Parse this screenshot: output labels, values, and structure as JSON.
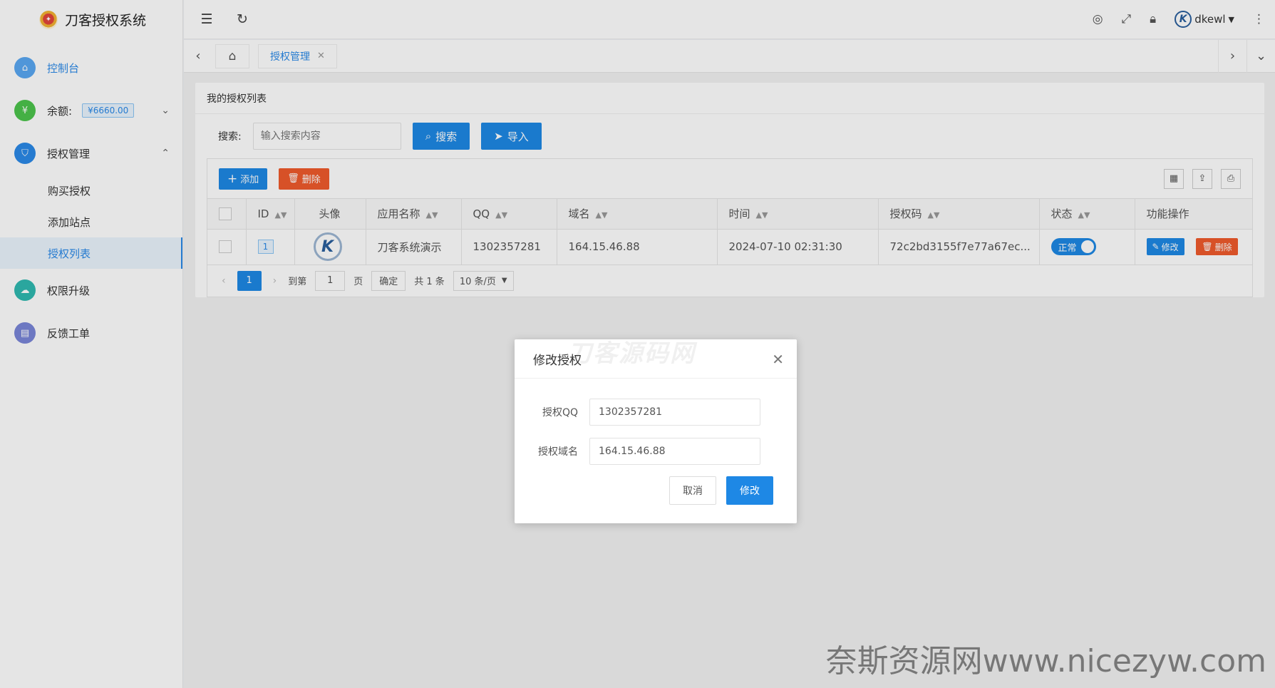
{
  "brand": {
    "title": "刀客授权系统"
  },
  "sidebar": {
    "items": [
      {
        "label": "控制台",
        "icon": "home-icon",
        "color": "#5aa7f2"
      },
      {
        "label": "余额:",
        "badge": "¥6660.00",
        "icon": "money-icon",
        "color": "#4cc54c"
      },
      {
        "label": "授权管理",
        "icon": "shield-icon",
        "color": "#2b8ae8"
      },
      {
        "label": "权限升级",
        "icon": "cloud-up-icon",
        "color": "#2fb9b0"
      },
      {
        "label": "反馈工单",
        "icon": "ticket-icon",
        "color": "#7a86d8"
      }
    ],
    "submenu": [
      {
        "label": "购买授权"
      },
      {
        "label": "添加站点"
      },
      {
        "label": "授权列表"
      }
    ]
  },
  "header": {
    "user": "dkewl"
  },
  "tabs": {
    "active": "授权管理"
  },
  "card": {
    "title": "我的授权列表",
    "search_label": "搜索:",
    "search_placeholder": "输入搜索内容",
    "search_button": "搜索",
    "import_button": "导入"
  },
  "toolbar": {
    "add": "添加",
    "delete": "删除"
  },
  "table": {
    "headers": [
      "ID",
      "头像",
      "应用名称",
      "QQ",
      "域名",
      "时间",
      "授权码",
      "状态",
      "功能操作"
    ],
    "rows": [
      {
        "id": "1",
        "app_name": "刀客系统演示",
        "qq": "1302357281",
        "domain": "164.15.46.88",
        "time": "2024-07-10 02:31:30",
        "code": "72c2bd3155f7e77a67ec...",
        "status": "正常",
        "edit": "修改",
        "delete": "删除"
      }
    ]
  },
  "pager": {
    "current": "1",
    "goto_label": "到第",
    "goto_value": "1",
    "page_label": "页",
    "confirm": "确定",
    "total": "共 1 条",
    "page_size": "10 条/页"
  },
  "modal": {
    "title": "修改授权",
    "watermark": "刀客源码网",
    "qq_label": "授权QQ",
    "qq_value": "1302357281",
    "domain_label": "授权域名",
    "domain_value": "164.15.46.88",
    "cancel": "取消",
    "ok": "修改"
  },
  "site_watermark": "奈斯资源网www.nicezyw.com"
}
